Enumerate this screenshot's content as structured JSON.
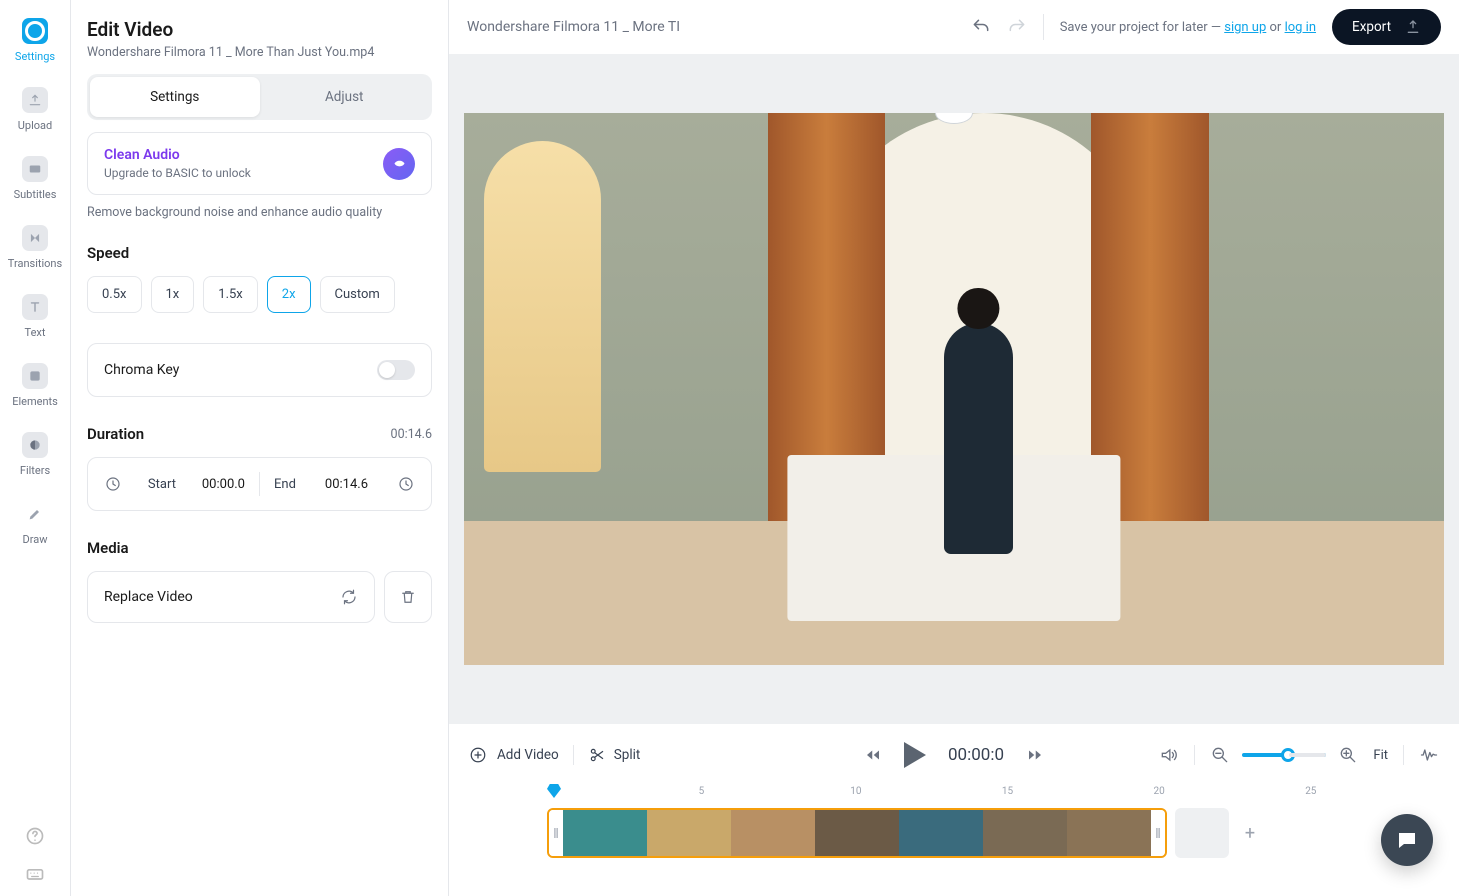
{
  "sidebar": {
    "items": [
      {
        "label": "Settings"
      },
      {
        "label": "Upload"
      },
      {
        "label": "Subtitles"
      },
      {
        "label": "Transitions"
      },
      {
        "label": "Text"
      },
      {
        "label": "Elements"
      },
      {
        "label": "Filters"
      },
      {
        "label": "Draw"
      }
    ]
  },
  "panel": {
    "title": "Edit Video",
    "filename": "Wondershare Filmora 11 _ More Than Just You.mp4",
    "tabs": {
      "settings": "Settings",
      "adjust": "Adjust"
    },
    "clean_audio": {
      "title": "Clean Audio",
      "subtitle": "Upgrade to BASIC to unlock",
      "desc": "Remove background noise and enhance audio quality"
    },
    "speed": {
      "heading": "Speed",
      "options": [
        "0.5x",
        "1x",
        "1.5x",
        "2x",
        "Custom"
      ],
      "active": "2x"
    },
    "chroma": {
      "label": "Chroma Key"
    },
    "duration": {
      "heading": "Duration",
      "total": "00:14.6",
      "start_label": "Start",
      "start_val": "00:00.0",
      "end_label": "End",
      "end_val": "00:14.6"
    },
    "media": {
      "heading": "Media",
      "replace": "Replace Video"
    }
  },
  "header": {
    "breadcrumb": "Wondershare Filmora 11 _ More TI",
    "save_prefix": "Save your project for later — ",
    "sign_up": "sign up",
    "or": " or ",
    "log_in": "log in",
    "export": "Export"
  },
  "controls": {
    "add_video": "Add Video",
    "split": "Split",
    "timecode": "00:00:0",
    "fit": "Fit",
    "timeline_marks": [
      "5",
      "10",
      "15",
      "20",
      "25"
    ],
    "add_clip": "+"
  }
}
